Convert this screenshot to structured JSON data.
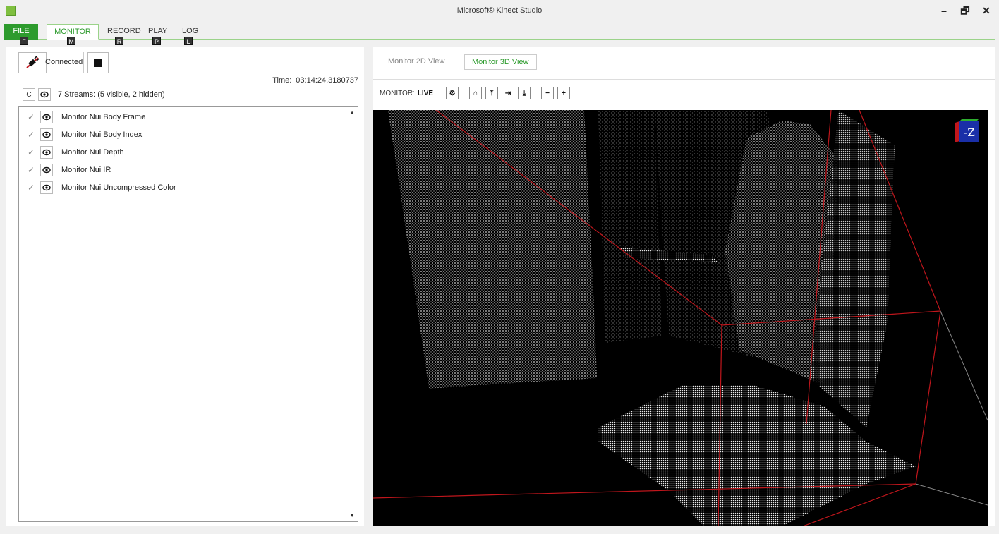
{
  "window": {
    "title": "Microsoft® Kinect Studio",
    "controls": [
      "–",
      "🗗",
      "✕"
    ]
  },
  "ribbon": {
    "tabs": [
      {
        "label": "FILE",
        "keytip": "F"
      },
      {
        "label": "MONITOR",
        "keytip": "M"
      },
      {
        "label": "RECORD",
        "keytip": "R"
      },
      {
        "label": "PLAY",
        "keytip": "P"
      },
      {
        "label": "LOG",
        "keytip": "L"
      }
    ]
  },
  "left": {
    "connection_label": "Connected",
    "time_label": "Time:",
    "time_value": "03:14:24.3180737",
    "clear_label": "C",
    "streams_summary": "7 Streams: (5 visible, 2 hidden)",
    "streams": [
      {
        "label": "Monitor Nui Body Frame",
        "checked": true
      },
      {
        "label": "Monitor Nui Body Index",
        "checked": true
      },
      {
        "label": "Monitor Nui Depth",
        "checked": true
      },
      {
        "label": "Monitor Nui IR",
        "checked": true
      },
      {
        "label": "Monitor Nui Uncompressed Color",
        "checked": true
      }
    ]
  },
  "right": {
    "view_tabs": [
      "Monitor 2D View",
      "Monitor 3D View"
    ],
    "active_view": "Monitor 3D View",
    "monitor_label": "MONITOR:",
    "monitor_state": "LIVE",
    "orientation_label": "-Z"
  },
  "colors": {
    "accent": "#2d9b2d",
    "frustum": "#c0161c",
    "viewport_bg": "#000000"
  }
}
